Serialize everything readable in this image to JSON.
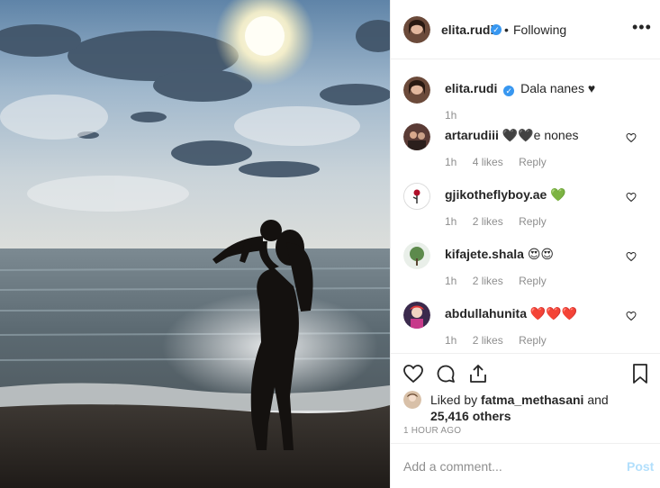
{
  "post": {
    "username": "elita.rudi",
    "separator": "•",
    "follow_state": "Following",
    "more_icon": "•••"
  },
  "caption": {
    "username": "elita.rudi",
    "text": "Dala nanes ♥",
    "time": "1h"
  },
  "comments": [
    {
      "username": "artarudiii",
      "text": "🖤🖤e nones",
      "time": "1h",
      "likes": "4 likes",
      "reply": "Reply"
    },
    {
      "username": "gjikotheflyboy.ae",
      "text": "💚",
      "time": "1h",
      "likes": "2 likes",
      "reply": "Reply"
    },
    {
      "username": "kifajete.shala",
      "text": "😍😍",
      "time": "1h",
      "likes": "2 likes",
      "reply": "Reply"
    },
    {
      "username": "abdullahunita",
      "text": "❤️❤️❤️",
      "time": "1h",
      "likes": "2 likes",
      "reply": "Reply"
    }
  ],
  "likes": {
    "prefix": "Liked by",
    "liker": "fatma_methasani",
    "joiner": "and",
    "others": "25,416 others"
  },
  "timestamp": "1 HOUR AGO",
  "add_comment": {
    "placeholder": "Add a comment...",
    "post_label": "Post"
  },
  "icons": {
    "heart": "heart-icon",
    "comment": "comment-icon",
    "share": "share-icon",
    "save": "bookmark-icon",
    "verified": "verified-badge-icon"
  },
  "colors": {
    "verified": "#3897f0",
    "post_disabled": "#b2dffc",
    "meta": "#8e8e8e"
  }
}
